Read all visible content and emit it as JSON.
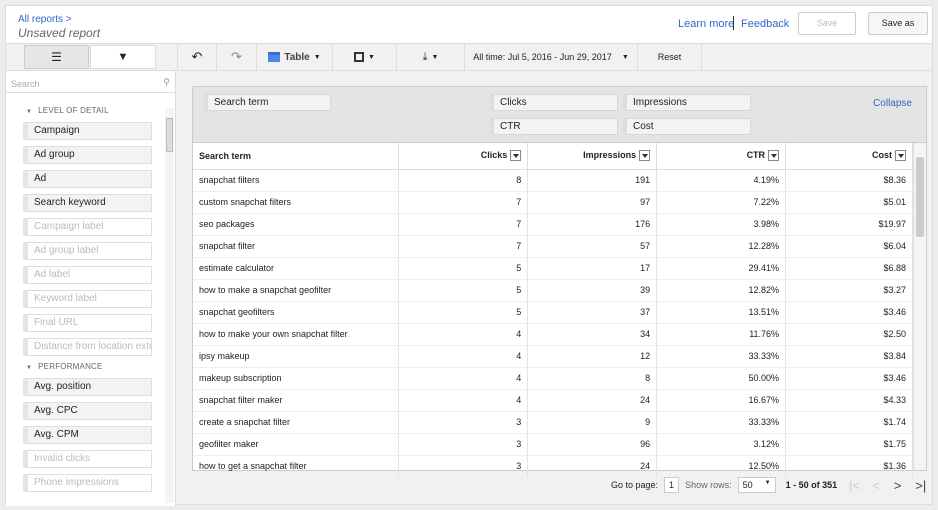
{
  "header": {
    "breadcrumb": "All reports >",
    "title": "Unsaved report",
    "learn_more": "Learn more",
    "feedback": "Feedback",
    "save": "Save",
    "save_as": "Save as"
  },
  "toolbar": {
    "view": "Table",
    "date_range": "All time: Jul 5, 2016 - Jun 29, 2017",
    "reset": "Reset"
  },
  "sidebar": {
    "search_placeholder": "Search",
    "sections": [
      {
        "title": "LEVEL OF DETAIL",
        "items": [
          {
            "label": "Campaign",
            "active": true
          },
          {
            "label": "Ad group",
            "active": true
          },
          {
            "label": "Ad",
            "active": true
          },
          {
            "label": "Search keyword",
            "active": true
          },
          {
            "label": "Campaign label",
            "active": false
          },
          {
            "label": "Ad group label",
            "active": false
          },
          {
            "label": "Ad label",
            "active": false
          },
          {
            "label": "Keyword label",
            "active": false
          },
          {
            "label": "Final URL",
            "active": false
          },
          {
            "label": "Distance from location exte",
            "active": false
          }
        ]
      },
      {
        "title": "PERFORMANCE",
        "items": [
          {
            "label": "Avg. position",
            "active": true
          },
          {
            "label": "Avg. CPC",
            "active": true
          },
          {
            "label": "Avg. CPM",
            "active": true
          },
          {
            "label": "Invalid clicks",
            "active": false
          },
          {
            "label": "Phone impressions",
            "active": false
          }
        ]
      }
    ]
  },
  "pivot": {
    "rows": [
      "Search term"
    ],
    "columns": [
      "Clicks",
      "Impressions",
      "CTR",
      "Cost"
    ],
    "collapse": "Collapse"
  },
  "table": {
    "headers": [
      "Search term",
      "Clicks",
      "Impressions",
      "CTR",
      "Cost"
    ],
    "rows": [
      [
        "snapchat filters",
        "8",
        "191",
        "4.19%",
        "$8.36"
      ],
      [
        "custom snapchat filters",
        "7",
        "97",
        "7.22%",
        "$5.01"
      ],
      [
        "seo packages",
        "7",
        "176",
        "3.98%",
        "$19.97"
      ],
      [
        "snapchat filter",
        "7",
        "57",
        "12.28%",
        "$6.04"
      ],
      [
        "estimate calculator",
        "5",
        "17",
        "29.41%",
        "$6.88"
      ],
      [
        "how to make a snapchat geofilter",
        "5",
        "39",
        "12.82%",
        "$3.27"
      ],
      [
        "snapchat geofilters",
        "5",
        "37",
        "13.51%",
        "$3.46"
      ],
      [
        "how to make your own snapchat filter",
        "4",
        "34",
        "11.76%",
        "$2.50"
      ],
      [
        "ipsy makeup",
        "4",
        "12",
        "33.33%",
        "$3.84"
      ],
      [
        "makeup subscription",
        "4",
        "8",
        "50.00%",
        "$3.46"
      ],
      [
        "snapchat filter maker",
        "4",
        "24",
        "16.67%",
        "$4.33"
      ],
      [
        "create a snapchat filter",
        "3",
        "9",
        "33.33%",
        "$1.74"
      ],
      [
        "geofilter maker",
        "3",
        "96",
        "3.12%",
        "$1.75"
      ],
      [
        "how to get a snapchat filter",
        "3",
        "24",
        "12.50%",
        "$1.36"
      ]
    ]
  },
  "pager": {
    "goto_label": "Go to page:",
    "page": "1",
    "rows_label": "Show rows:",
    "rows": "50",
    "range": "1 - 50 of 351"
  }
}
